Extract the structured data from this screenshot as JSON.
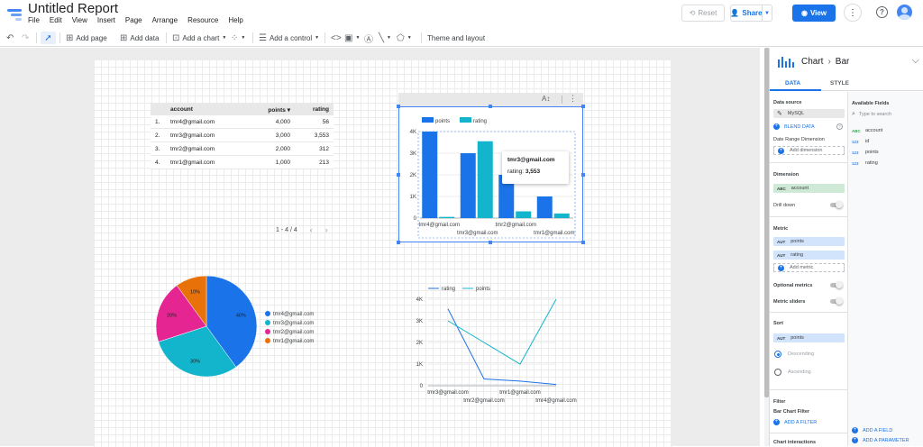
{
  "header": {
    "title": "Untitled Report",
    "menus": [
      "File",
      "Edit",
      "View",
      "Insert",
      "Page",
      "Arrange",
      "Resource",
      "Help"
    ],
    "reset_label": "Reset",
    "share_label": "Share",
    "view_label": "View"
  },
  "toolbar": {
    "add_page": "Add page",
    "add_data": "Add data",
    "add_chart": "Add a chart",
    "add_control": "Add a control",
    "theme": "Theme and layout"
  },
  "table": {
    "headers": [
      "account",
      "points ▾",
      "rating"
    ],
    "rows": [
      {
        "idx": "1.",
        "account": "tmr4@gmail.com",
        "points": "4,000",
        "rating": "56"
      },
      {
        "idx": "2.",
        "account": "tmr3@gmail.com",
        "points": "3,000",
        "rating": "3,553"
      },
      {
        "idx": "3.",
        "account": "tmr2@gmail.com",
        "points": "2,000",
        "rating": "312"
      },
      {
        "idx": "4.",
        "account": "tmr1@gmail.com",
        "points": "1,000",
        "rating": "213"
      }
    ],
    "pager": "1 - 4 / 4"
  },
  "tooltip": {
    "account": "tmr3@gmail.com",
    "label": "rating:",
    "value": "3,553"
  },
  "colors": {
    "points": "#1a73e8",
    "rating": "#12b5cb",
    "pie": [
      "#1a73e8",
      "#12b5cb",
      "#e52592",
      "#e8710a"
    ],
    "accent": "#1a73e8"
  },
  "chart_data": [
    {
      "type": "bar",
      "categories": [
        "tmr4@gmail.com",
        "tmr3@gmail.com",
        "tmr2@gmail.com",
        "tmr1@gmail.com"
      ],
      "series": [
        {
          "name": "points",
          "values": [
            4000,
            3000,
            2000,
            1000
          ]
        },
        {
          "name": "rating",
          "values": [
            56,
            3553,
            312,
            213
          ]
        }
      ],
      "y_ticks": [
        "0",
        "1K",
        "2K",
        "3K",
        "4K"
      ],
      "ylim": [
        0,
        4000
      ],
      "legend": "top-left"
    },
    {
      "type": "pie",
      "labels": [
        "tmr4@gmail.com",
        "tmr3@gmail.com",
        "tmr2@gmail.com",
        "tmr1@gmail.com"
      ],
      "values": [
        40,
        30,
        20,
        10
      ],
      "slice_labels": [
        "40%",
        "30%",
        "20%",
        "10%"
      ],
      "legend": "right"
    },
    {
      "type": "line",
      "categories": [
        "tmr3@gmail.com",
        "tmr2@gmail.com",
        "tmr1@gmail.com",
        "tmr4@gmail.com"
      ],
      "series": [
        {
          "name": "rating",
          "values": [
            3553,
            312,
            213,
            56
          ]
        },
        {
          "name": "points",
          "values": [
            3000,
            2000,
            1000,
            4000
          ]
        }
      ],
      "y_ticks": [
        "0",
        "1K",
        "2K",
        "3K",
        "4K"
      ],
      "ylim": [
        0,
        4000
      ],
      "legend": "top"
    }
  ],
  "panel": {
    "chart_label": "Chart",
    "chart_type": "Bar",
    "tab_data": "DATA",
    "tab_style": "STYLE",
    "data_source_title": "Data source",
    "data_source": "MySQL",
    "blend": "BLEND DATA",
    "date_range_title": "Date Range Dimension",
    "add_dimension": "Add dimension",
    "dimension_title": "Dimension",
    "dimension": "account",
    "drill_down": "Drill down",
    "metric_title": "Metric",
    "metrics": [
      "points",
      "rating"
    ],
    "add_metric": "Add metric",
    "optional_metrics": "Optional metrics",
    "metric_sliders": "Metric sliders",
    "sort_title": "Sort",
    "sort_field": "points",
    "descending": "Descending",
    "ascending": "Ascending",
    "filter_title": "Filter",
    "filter_sub": "Bar Chart Filter",
    "add_filter": "ADD A FILTER",
    "chart_interactions": "Chart interactions",
    "available_fields": "Available Fields",
    "search_placeholder": "Type to search",
    "fields": [
      {
        "type": "ABC",
        "name": "account"
      },
      {
        "type": "123",
        "name": "id"
      },
      {
        "type": "123",
        "name": "points"
      },
      {
        "type": "123",
        "name": "rating"
      }
    ],
    "add_field": "ADD A FIELD",
    "add_parameter": "ADD A PARAMETER",
    "type_text": "ABC",
    "type_num": "AUT"
  }
}
